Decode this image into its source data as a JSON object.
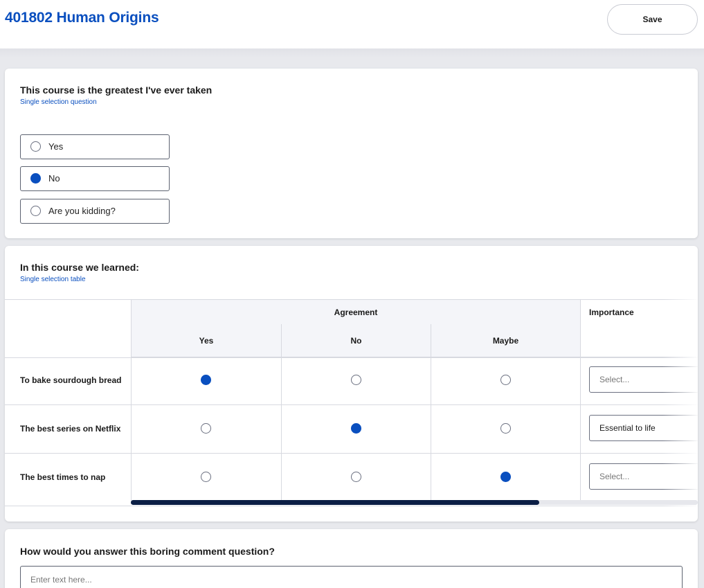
{
  "header": {
    "title": "401802 Human Origins",
    "save_label": "Save"
  },
  "q1": {
    "title": "This course is the greatest I've ever taken",
    "subtitle": "Single selection question",
    "options": [
      {
        "label": "Yes",
        "selected": false
      },
      {
        "label": "No",
        "selected": true
      },
      {
        "label": "Are you kidding?",
        "selected": false
      }
    ]
  },
  "q2": {
    "title": "In this course we learned:",
    "subtitle": "Single selection table",
    "group_header": "Agreement",
    "importance_header": "Importance",
    "columns": [
      "Yes",
      "No",
      "Maybe"
    ],
    "rows": [
      {
        "label": "To bake sourdough bread",
        "selected": "Yes",
        "importance": "Select..."
      },
      {
        "label": "The best series on Netflix",
        "selected": "No",
        "importance": "Essential to life"
      },
      {
        "label": "The best times to nap",
        "selected": "Maybe",
        "importance": "Select..."
      }
    ],
    "scroll_fraction": 0.72
  },
  "q3": {
    "title": "How would you answer this boring comment question?",
    "placeholder": "Enter text here..."
  },
  "colors": {
    "accent": "#0a4fbf",
    "scroll_thumb": "#0b1e45",
    "table_header_bg": "#f4f5f9"
  }
}
